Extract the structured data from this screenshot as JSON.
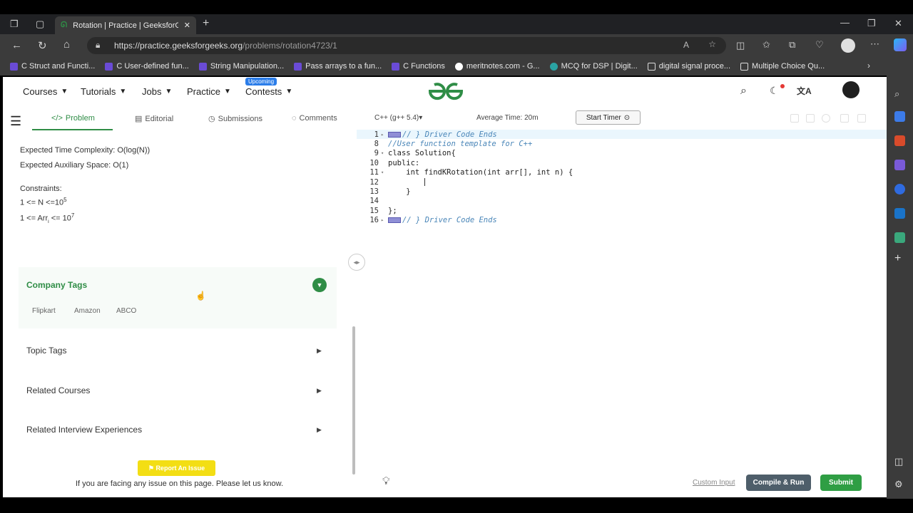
{
  "browser": {
    "tab_title": "Rotation | Practice | GeeksforGee",
    "url_main": "https://practice.geeksforgeeks.org",
    "url_path": "/problems/rotation4723/1",
    "bookmarks": [
      {
        "label": "C Struct and Functi...",
        "color": "#6a4bd6"
      },
      {
        "label": "C User-defined fun...",
        "color": "#6a4bd6"
      },
      {
        "label": "String Manipulation...",
        "color": "#6a4bd6"
      },
      {
        "label": "Pass arrays to a fun...",
        "color": "#6a4bd6"
      },
      {
        "label": "C Functions",
        "color": "#6a4bd6"
      },
      {
        "label": "meritnotes.com - G...",
        "color": "#ffffff"
      },
      {
        "label": "MCQ for DSP | Digit...",
        "color": "#2aa3a3"
      },
      {
        "label": "digital signal proce...",
        "color": "#dddddd"
      },
      {
        "label": "Multiple Choice Qu...",
        "color": "#dddddd"
      }
    ]
  },
  "nav": {
    "courses": "Courses",
    "tutorials": "Tutorials",
    "jobs": "Jobs",
    "practice": "Practice",
    "contests": "Contests",
    "upcoming_badge": "Upcoming"
  },
  "problem_tabs": {
    "problem": "Problem",
    "editorial": "Editorial",
    "submissions": "Submissions",
    "comments": "Comments"
  },
  "problem": {
    "time_label": "Expected Time Complexity:",
    "time_value": "O(log(N))",
    "space_label": "Expected Auxiliary Space:",
    "space_value": "O(1)",
    "constraints_label": "Constraints:",
    "constraint1_left": "1 <= N <=10",
    "constraint1_exp": "5",
    "constraint2_left": "1 <= Arr",
    "constraint2_sub": "i",
    "constraint2_mid": " <= 10",
    "constraint2_exp": "7"
  },
  "company_tags": {
    "title": "Company Tags",
    "tags": [
      "Flipkart",
      "Amazon",
      "ABCO"
    ]
  },
  "accordions": {
    "topic_tags": "Topic Tags",
    "related_courses": "Related Courses",
    "related_interview": "Related Interview Experiences"
  },
  "report": {
    "button": "Report An Issue",
    "text": "If you are facing any issue on this page. Please let us know."
  },
  "editor": {
    "language": "C++ (g++ 5.4)",
    "avg_time": "Average Time: 20m",
    "start_timer": "Start Timer",
    "lines": [
      {
        "num": "1",
        "fold": "▸",
        "text": "// } Driver Code Ends",
        "comment": true,
        "marker": true,
        "hl": true
      },
      {
        "num": "8",
        "fold": "",
        "text": "//User function template for C++",
        "comment": true,
        "marker": false,
        "hl": false
      },
      {
        "num": "9",
        "fold": "▾",
        "text": "class Solution{",
        "comment": false,
        "marker": false,
        "hl": false
      },
      {
        "num": "10",
        "fold": "",
        "text": "public:",
        "comment": false,
        "marker": false,
        "hl": false
      },
      {
        "num": "11",
        "fold": "▾",
        "text": "    int findKRotation(int arr[], int n) {",
        "comment": false,
        "marker": false,
        "hl": false
      },
      {
        "num": "12",
        "fold": "",
        "text": "        ",
        "comment": false,
        "marker": false,
        "hl": false
      },
      {
        "num": "13",
        "fold": "",
        "text": "    }",
        "comment": false,
        "marker": false,
        "hl": false
      },
      {
        "num": "14",
        "fold": "",
        "text": "",
        "comment": false,
        "marker": false,
        "hl": false
      },
      {
        "num": "15",
        "fold": "",
        "text": "};",
        "comment": false,
        "marker": false,
        "hl": false
      },
      {
        "num": "16",
        "fold": "▸",
        "text": "// } Driver Code Ends",
        "comment": true,
        "marker": true,
        "hl": false
      }
    ],
    "custom_input": "Custom Input",
    "compile_run": "Compile & Run",
    "submit": "Submit"
  }
}
